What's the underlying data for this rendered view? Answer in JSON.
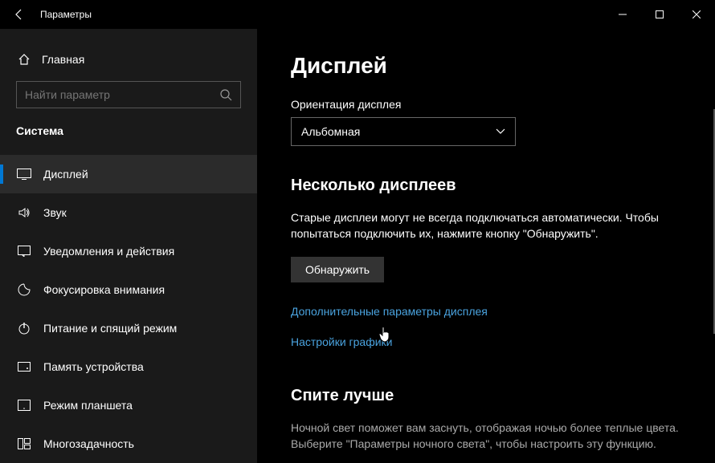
{
  "titlebar": {
    "title": "Параметры"
  },
  "sidebar": {
    "home_label": "Главная",
    "search_placeholder": "Найти параметр",
    "section_label": "Система",
    "items": [
      {
        "label": "Дисплей",
        "icon": "display"
      },
      {
        "label": "Звук",
        "icon": "sound"
      },
      {
        "label": "Уведомления и действия",
        "icon": "notifications"
      },
      {
        "label": "Фокусировка внимания",
        "icon": "focus"
      },
      {
        "label": "Питание и спящий режим",
        "icon": "power"
      },
      {
        "label": "Память устройства",
        "icon": "storage"
      },
      {
        "label": "Режим планшета",
        "icon": "tablet"
      },
      {
        "label": "Многозадачность",
        "icon": "multitasking"
      }
    ]
  },
  "content": {
    "page_title": "Дисплей",
    "orientation_label": "Ориентация дисплея",
    "orientation_value": "Альбомная",
    "multi_display_heading": "Несколько дисплеев",
    "multi_display_desc": "Старые дисплеи могут не всегда подключаться автоматически. Чтобы попытаться подключить их, нажмите кнопку \"Обнаружить\".",
    "detect_button": "Обнаружить",
    "advanced_link": "Дополнительные параметры дисплея",
    "graphics_link": "Настройки графики",
    "sleep_heading": "Спите лучше",
    "sleep_desc": "Ночной свет поможет вам заснуть, отображая ночью более теплые цвета. Выберите \"Параметры ночного света\", чтобы настроить эту функцию."
  }
}
